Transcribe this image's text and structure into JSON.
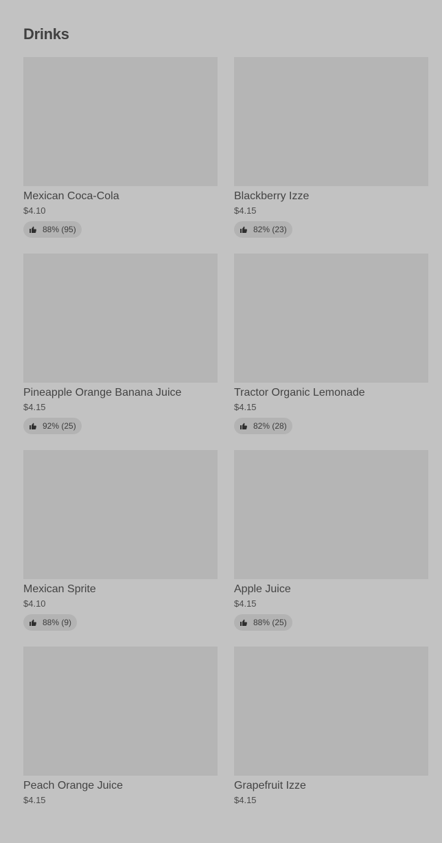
{
  "section": {
    "title": "Drinks"
  },
  "items": [
    {
      "name": "Mexican Coca-Cola",
      "price": "$4.10",
      "rating": "88% (95)"
    },
    {
      "name": "Blackberry Izze",
      "price": "$4.15",
      "rating": "82% (23)"
    },
    {
      "name": "Pineapple Orange Banana Juice",
      "price": "$4.15",
      "rating": "92% (25)"
    },
    {
      "name": "Tractor Organic Lemonade",
      "price": "$4.15",
      "rating": "82% (28)"
    },
    {
      "name": "Mexican Sprite",
      "price": "$4.10",
      "rating": "88% (9)"
    },
    {
      "name": "Apple Juice",
      "price": "$4.15",
      "rating": "88% (25)"
    },
    {
      "name": "Peach Orange Juice",
      "price": "$4.15",
      "rating": ""
    },
    {
      "name": "Grapefruit Izze",
      "price": "$4.15",
      "rating": ""
    }
  ],
  "icons": {
    "rating": "thumbs-up-icon"
  },
  "colors": {
    "background": "#c2c2c2",
    "thumbnail": "#b5b5b5",
    "rating_pill": "#b3b3b3",
    "text": "#414141"
  }
}
